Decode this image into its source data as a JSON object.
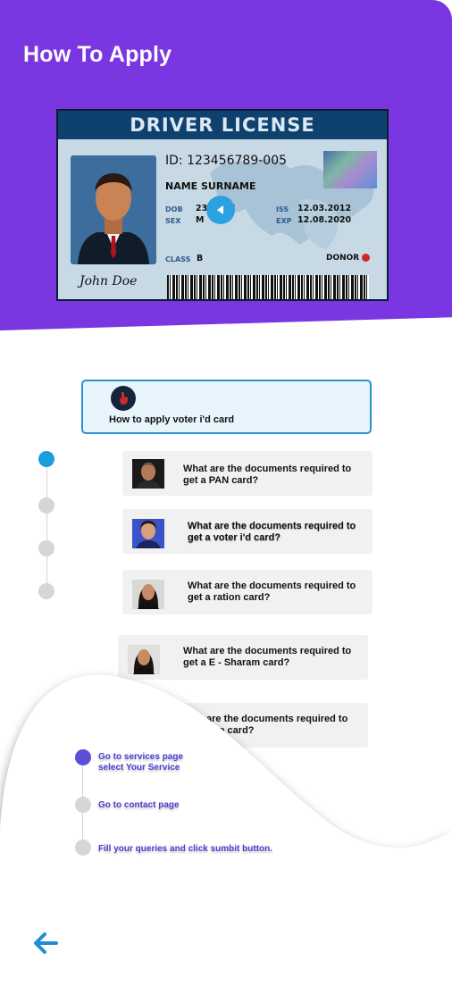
{
  "header": {
    "title": "How To Apply",
    "background_color": "#7a37e1"
  },
  "license_card": {
    "heading": "DRIVER LICENSE",
    "id_line": "ID: 123456789-005",
    "name": "NAME SURNAME",
    "dob_label": "DOB",
    "dob_value": "23.___97",
    "sex_label": "SEX",
    "sex_value": "M",
    "iss_label": "ISS",
    "iss_value": "12.03.2012",
    "exp_label": "EXP",
    "exp_value": "12.08.2020",
    "class_label": "CLASS",
    "class_value": "B",
    "donor_label": "DONOR",
    "signature": "John Doe",
    "play_icon": "play-back-icon"
  },
  "voter_card": {
    "icon": "touch-app-icon",
    "label": "How to apply voter i'd card"
  },
  "questions": [
    {
      "line1": "What are the documents required to",
      "line2": "get a PAN card?"
    },
    {
      "line1": "What are the documents required to",
      "line2": "get a voter i'd card?"
    },
    {
      "line1": "What are the documents required to",
      "line2": "get a ration card?"
    },
    {
      "line1": "What are the documents required to",
      "line2": "get a E - Sharam card?"
    },
    {
      "line1": "are the documents required to",
      "line2": "ion card?"
    }
  ],
  "steps": [
    {
      "line1": "Go to services page",
      "line2": "select Your Service"
    },
    {
      "line1": "Go to contact  page",
      "line2": ""
    },
    {
      "line1": "Fill your queries  and click sumbit button.",
      "line2": ""
    }
  ],
  "back_icon": "arrow-left-icon",
  "colors": {
    "timeline_active": "#1b9ee0",
    "step_active": "#5a4fd6",
    "step_text": "#4c3fd0"
  }
}
